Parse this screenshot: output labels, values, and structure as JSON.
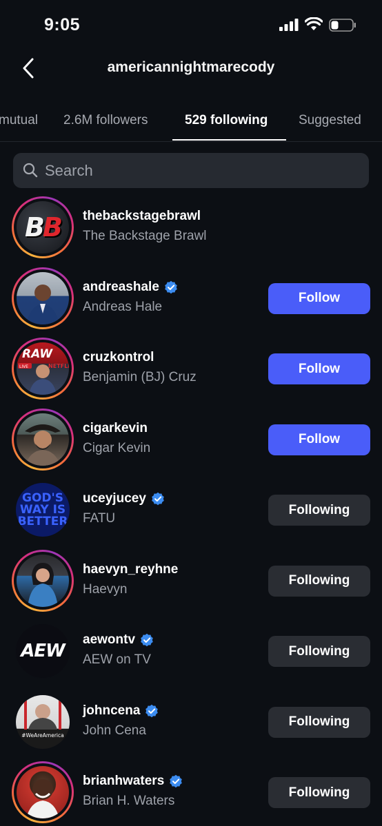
{
  "status_bar": {
    "time": "9:05"
  },
  "header": {
    "title": "americannightmarecody"
  },
  "tabs": [
    {
      "label": "mutual",
      "active": false
    },
    {
      "label": "2.6M followers",
      "active": false
    },
    {
      "label": "529 following",
      "active": true
    },
    {
      "label": "Suggested",
      "active": false
    }
  ],
  "search": {
    "placeholder": "Search"
  },
  "accounts": [
    {
      "username": "thebackstagebrawl",
      "name": "The Backstage Brawl",
      "verified": false,
      "button": ""
    },
    {
      "username": "andreashale",
      "name": "Andreas Hale",
      "verified": true,
      "button": "Follow"
    },
    {
      "username": "cruzkontrol",
      "name": "Benjamin (BJ) Cruz",
      "verified": false,
      "button": "Follow"
    },
    {
      "username": "cigarkevin",
      "name": "Cigar Kevin",
      "verified": false,
      "button": "Follow"
    },
    {
      "username": "uceyjucey",
      "name": "FATU",
      "verified": true,
      "button": "Following"
    },
    {
      "username": "haevyn_reyhne",
      "name": "Haevyn",
      "verified": false,
      "button": "Following"
    },
    {
      "username": "aewontv",
      "name": "AEW on TV",
      "verified": true,
      "button": "Following"
    },
    {
      "username": "johncena",
      "name": "John Cena",
      "verified": true,
      "button": "Following"
    },
    {
      "username": "brianhwaters",
      "name": "Brian H. Waters",
      "verified": true,
      "button": "Following"
    }
  ],
  "avatar_text": {
    "backstage": [
      "B",
      "B"
    ],
    "uceyjucey": "GOD'S WAY IS BETTER",
    "aewontv": "AEW",
    "cruz": [
      "RAW",
      "LIVE",
      "NETFLIX"
    ],
    "cena": "#WeAreAmerica"
  },
  "colors": {
    "background": "#0c0f14",
    "follow_button": "#4a5df9",
    "following_button": "#2a2d33",
    "verified_badge": "#3c8cf0",
    "secondary_text": "#9ea2aa"
  }
}
